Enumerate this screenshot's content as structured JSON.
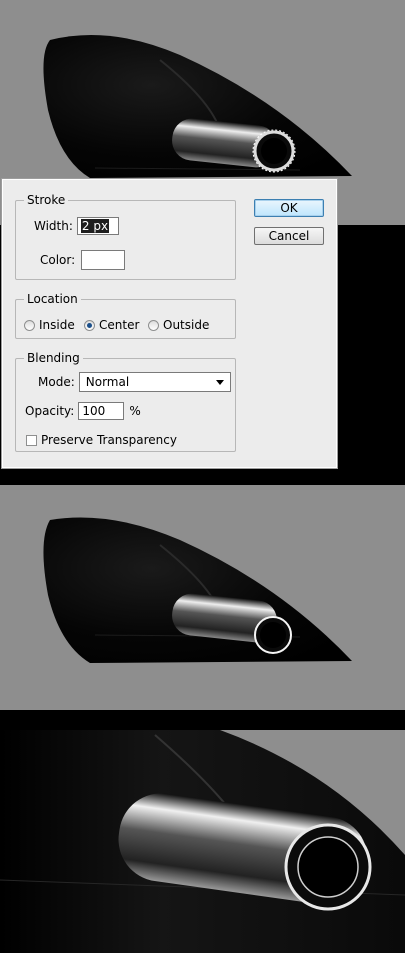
{
  "dialog": {
    "ok_label": "OK",
    "cancel_label": "Cancel",
    "stroke": {
      "legend": "Stroke",
      "width_label": "Width:",
      "width_value": "2 px",
      "color_label": "Color:",
      "color_value": "#ffffff"
    },
    "location": {
      "legend": "Location",
      "options": [
        "Inside",
        "Center",
        "Outside"
      ],
      "selected": "Center"
    },
    "blending": {
      "legend": "Blending",
      "mode_label": "Mode:",
      "mode_value": "Normal",
      "opacity_label": "Opacity:",
      "opacity_value": "100",
      "opacity_unit": "%",
      "preserve_label": "Preserve Transparency",
      "preserve_checked": false
    }
  },
  "colors": {
    "canvas_gray": "#8e8e8e",
    "shape_black": "#000000",
    "dialog_bg": "#ececec",
    "ok_accent": "#3c7fb1"
  }
}
